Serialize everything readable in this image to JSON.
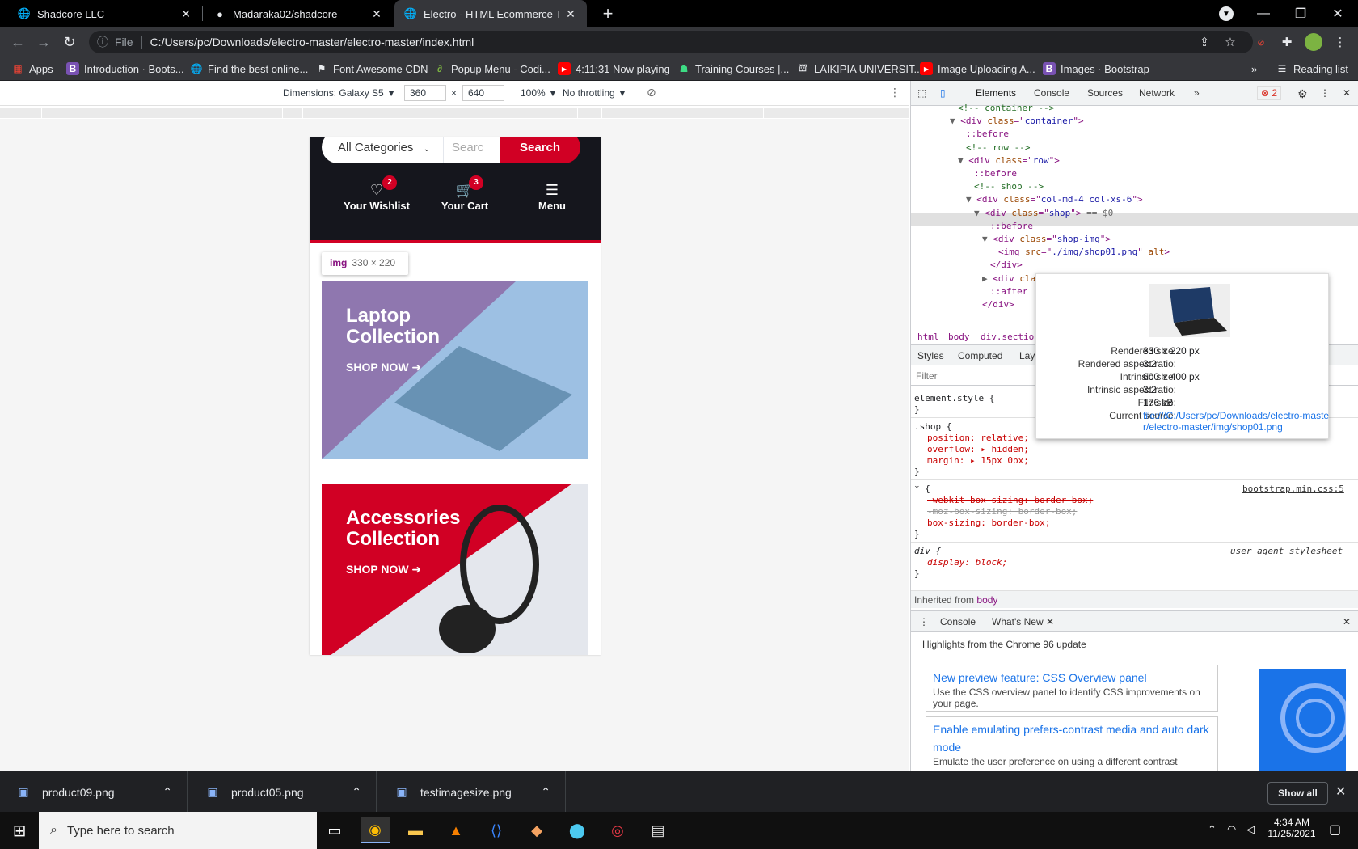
{
  "browser": {
    "tabs": [
      {
        "title": "Shadcore LLC",
        "active": false
      },
      {
        "title": "Madaraka02/shadcore",
        "active": false
      },
      {
        "title": "Electro - HTML Ecommerce Temp",
        "active": true
      }
    ],
    "address": {
      "scheme": "File",
      "url": "C:/Users/pc/Downloads/electro-master/electro-master/index.html"
    },
    "bookmarks": [
      {
        "label": "Apps",
        "icon": "apps-grid-icon"
      },
      {
        "label": "Introduction · Boots...",
        "icon": "bootstrap-icon"
      },
      {
        "label": "Find the best online...",
        "icon": "globe-icon"
      },
      {
        "label": "Font Awesome CDN",
        "icon": "flag-icon"
      },
      {
        "label": "Popup Menu - Codi...",
        "icon": "codingnepal-icon"
      },
      {
        "label": "4:11:31 Now playing",
        "icon": "youtube-icon"
      },
      {
        "label": "Training Courses |...",
        "icon": "training-icon"
      },
      {
        "label": "LAIKIPIA UNIVERSIT...",
        "icon": "university-icon"
      },
      {
        "label": "Image Uploading A...",
        "icon": "youtube-icon"
      },
      {
        "label": "Images · Bootstrap",
        "icon": "bootstrap-icon"
      }
    ],
    "reading_list": "Reading list",
    "more_bookmarks": "»"
  },
  "device_toolbar": {
    "dimensions_label": "Dimensions: Galaxy S5",
    "width": "360",
    "height": "640",
    "zoom": "100%",
    "throttling": "No throttling",
    "times": "×"
  },
  "site": {
    "category_select": "All Categories",
    "search_placeholder": "Searc",
    "search_button": "Search",
    "wishlist": {
      "label": "Your Wishlist",
      "count": "2"
    },
    "cart": {
      "label": "Your Cart",
      "count": "3"
    },
    "menu": {
      "label": "Menu"
    },
    "tooltip": {
      "tag": "img",
      "dims": "330 × 220"
    },
    "cards": [
      {
        "title_line1": "Laptop",
        "title_line2": "Collection",
        "cta": "SHOP NOW",
        "color": "#8e6fa8"
      },
      {
        "title_line1": "Accessories",
        "title_line2": "Collection",
        "cta": "SHOP NOW",
        "color": "#d10024"
      }
    ]
  },
  "devtools": {
    "tabs": [
      "Elements",
      "Console",
      "Sources",
      "Network",
      "»"
    ],
    "error_count": "2",
    "dom_lines": [
      {
        "indent": 5,
        "kind": "comment",
        "text": "<!-- container -->"
      },
      {
        "indent": 4,
        "kind": "open",
        "arrow": "▼",
        "tag": "div",
        "attr": "class",
        "val": "container"
      },
      {
        "indent": 6,
        "kind": "pseudo",
        "text": "::before"
      },
      {
        "indent": 6,
        "kind": "comment",
        "text": "<!-- row -->"
      },
      {
        "indent": 5,
        "kind": "open",
        "arrow": "▼",
        "tag": "div",
        "attr": "class",
        "val": "row"
      },
      {
        "indent": 7,
        "kind": "pseudo",
        "text": "::before"
      },
      {
        "indent": 7,
        "kind": "comment",
        "text": "<!-- shop -->"
      },
      {
        "indent": 6,
        "kind": "open",
        "arrow": "▼",
        "tag": "div",
        "attr": "class",
        "val": "col-md-4 col-xs-6"
      },
      {
        "indent": 7,
        "kind": "open",
        "arrow": "▼",
        "tag": "div",
        "attr": "class",
        "val": "shop",
        "suffix": " == $0"
      },
      {
        "indent": 9,
        "kind": "pseudo",
        "text": "::before"
      },
      {
        "indent": 8,
        "kind": "open",
        "arrow": "▼",
        "tag": "div",
        "attr": "class",
        "val": "shop-img"
      },
      {
        "indent": 10,
        "kind": "img",
        "text": "<img src=\"./img/shop01.png\" alt>"
      },
      {
        "indent": 9,
        "kind": "close",
        "text": "</div>"
      },
      {
        "indent": 8,
        "kind": "open",
        "arrow": "▶",
        "tag": "div",
        "attr": "clas",
        "val": ""
      },
      {
        "indent": 9,
        "kind": "pseudo",
        "text": "::after"
      },
      {
        "indent": 8,
        "kind": "close",
        "text": "</div>"
      }
    ],
    "breadcrumb": [
      "html",
      "body",
      "div.section"
    ],
    "style_tabs": [
      "Styles",
      "Computed",
      "Layo"
    ],
    "filter_placeholder": "Filter",
    "image_popup": {
      "rendered_size_label": "Rendered size:",
      "rendered_size": "330 × 220 px",
      "rendered_ar_label": "Rendered aspect ratio:",
      "rendered_ar": "3:2",
      "intrinsic_size_label": "Intrinsic size:",
      "intrinsic_size": "600 × 400 px",
      "intrinsic_ar_label": "Intrinsic aspect ratio:",
      "intrinsic_ar": "3:2",
      "file_size_label": "File size:",
      "file_size": "176 kB",
      "source_label": "Current source:",
      "source_line1": "file:///C:/Users/pc/Downloads/electro-maste",
      "source_line2": "r/electro-master/img/shop01.png"
    },
    "styles": {
      "element_style": "element.style {",
      "close_brace": "}",
      "shop_selector": ".shop {",
      "shop_props": [
        "position: relative;",
        "overflow: ▸ hidden;",
        "margin: ▸ 15px 0px;"
      ],
      "star_selector": "* {",
      "star_source": "bootstrap.min.css:5",
      "star_props": [
        "-webkit-box-sizing: border-box;",
        "-moz-box-sizing: border-box;",
        "box-sizing: border-box;"
      ],
      "div_selector": "div {",
      "div_source": "user agent stylesheet",
      "div_prop": "display: block;",
      "inherited_label": "Inherited from",
      "inherited_from": "body"
    },
    "drawer": {
      "tabs": [
        "Console",
        "What's New"
      ],
      "highlights": "Highlights from the Chrome 96 update",
      "cards": [
        {
          "title": "New preview feature: CSS Overview panel",
          "desc": "Use the CSS overview panel to identify CSS improvements on your page."
        },
        {
          "title": "Enable emulating prefers-contrast media and auto dark mode",
          "desc": "Emulate the user preference on using a different contrast"
        }
      ]
    }
  },
  "downloads": {
    "items": [
      "product09.png",
      "product05.png",
      "testimagesize.png"
    ],
    "show_all": "Show all"
  },
  "taskbar": {
    "search_placeholder": "Type here to search",
    "time": "4:34 AM",
    "date": "11/25/2021"
  }
}
